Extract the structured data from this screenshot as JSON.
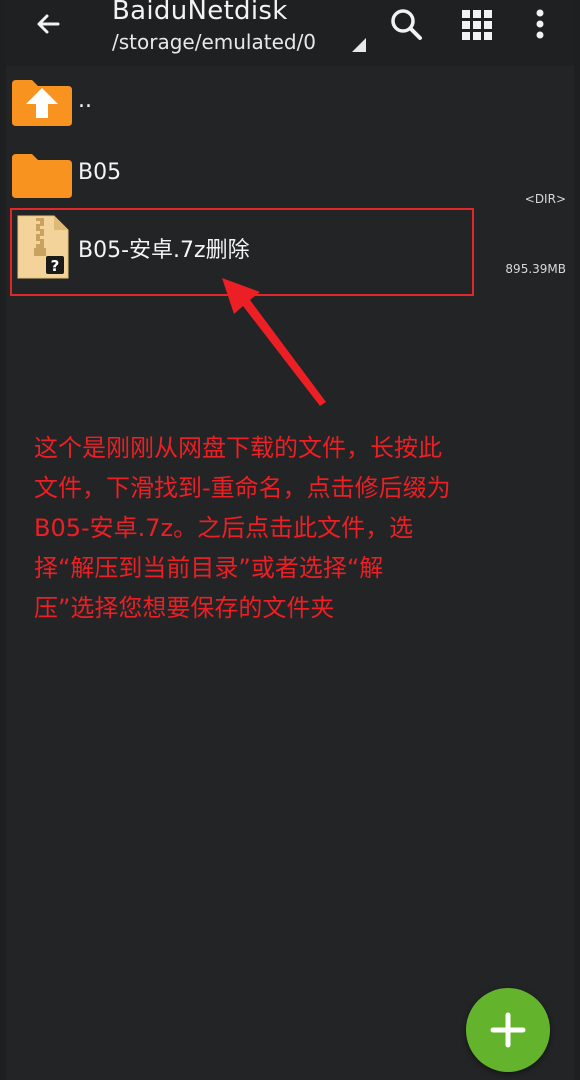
{
  "appbar": {
    "title": "BaiduNetdisk",
    "path": "/storage/emulated/0"
  },
  "files": [
    {
      "name": "..",
      "type": "parent-folder",
      "meta": ""
    },
    {
      "name": "B05",
      "type": "folder",
      "meta": "<DIR>"
    },
    {
      "name": "B05-安卓.7z删除",
      "type": "archive",
      "meta": "895.39MB"
    }
  ],
  "annotation": {
    "text": "这个是刚刚从网盘下载的文件，长按此\n文件，下滑找到-重命名，点击修后缀为\nB05-安卓.7z。之后点击此文件，选\n择“解压到当前目录”或者选择“解\n压”选择您想要保存的文件夹"
  },
  "colors": {
    "folder": "#f7931e",
    "annotation": "#ec1f24",
    "fab": "#64b32c"
  },
  "icons": [
    "back-arrow-icon",
    "search-icon",
    "grid-view-icon",
    "more-vert-icon",
    "folder-up-icon",
    "folder-icon",
    "archive-file-icon",
    "plus-icon"
  ]
}
